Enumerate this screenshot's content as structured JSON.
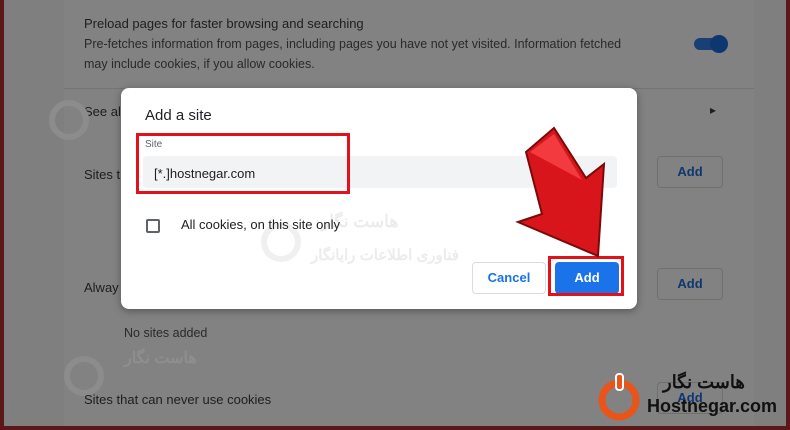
{
  "settings": {
    "preload_title": "Preload pages for faster browsing and searching",
    "preload_desc_1": "Pre-fetches information from pages, including pages you have not yet visited. Information fetched",
    "preload_desc_2": "may include cookies, if you allow cookies.",
    "see_all": "See all",
    "sites_that_partial": "Sites th",
    "always_partial": "Alway",
    "no_sites": "No sites added",
    "never_cookies": "Sites that can never use cookies",
    "add_label": "Add"
  },
  "dialog": {
    "title": "Add a site",
    "site_label": "Site",
    "site_value": "[*.]hostnegar.com",
    "checkbox_label": "All cookies, on this site only",
    "cancel_label": "Cancel",
    "add_label": "Add"
  },
  "watermark": {
    "fa_name": "هاست نگار",
    "fa_tagline": "فناوری اطلاعات رایانگار"
  },
  "brand": {
    "fa": "هاست نگار",
    "en": "Hostnegar.com"
  },
  "colors": {
    "accent": "#1a73e8",
    "highlight": "#e3121a",
    "brand_orange": "#e8541a"
  }
}
